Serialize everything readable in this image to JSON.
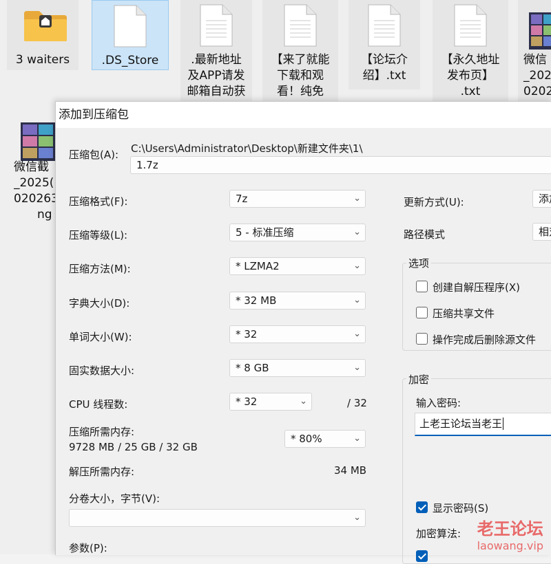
{
  "desktop": {
    "files": [
      {
        "label": "3 waiters"
      },
      {
        "label": ".DS_Store"
      },
      {
        "label_lines": [
          ".最新地址",
          "及APP请发",
          "邮箱自动获"
        ]
      },
      {
        "label_lines": [
          "【来了就能",
          "下载和观",
          "看！纯免"
        ]
      },
      {
        "label_lines": [
          "【论坛介",
          "绍】.txt"
        ]
      },
      {
        "label_lines": [
          "【永久地址",
          "发布页】",
          ".txt"
        ]
      },
      {
        "label_lines": [
          "微信",
          "_202",
          "0202"
        ]
      },
      {
        "label_lines": [
          "微信截",
          "_2025(",
          "020263",
          "ng"
        ]
      }
    ]
  },
  "dialog": {
    "title": "添加到压缩包",
    "archive_label": "压缩包(A):",
    "archive_path": "C:\\Users\\Administrator\\Desktop\\新建文件夹\\1\\",
    "archive_name": "1.7z",
    "format_label": "压缩格式(F):",
    "format_value": "7z",
    "level_label": "压缩等级(L):",
    "level_value": "5 - 标准压缩",
    "method_label": "压缩方法(M):",
    "method_value": "*  LZMA2",
    "dict_label": "字典大小(D):",
    "dict_value": "*  32 MB",
    "word_label": "单词大小(W):",
    "word_value": "*  32",
    "solid_label": "固实数据大小:",
    "solid_value": "*  8 GB",
    "cpu_label": "CPU 线程数:",
    "cpu_value": "*  32",
    "cpu_total": "/ 32",
    "mem_label": "压缩所需内存:",
    "mem_value": "9728 MB / 25 GB / 32 GB",
    "mem_percent": "*  80%",
    "decomp_label": "解压所需内存:",
    "decomp_value": "34 MB",
    "split_label": "分卷大小，字节(V):",
    "split_value": "",
    "params_label": "参数(P):",
    "update_label": "更新方式(U):",
    "update_value": "添加",
    "path_label": "路径模式",
    "path_value": "相对",
    "options_title": "选项",
    "opt_sfx": "创建自解压程序(X)",
    "opt_shared": "压缩共享文件",
    "opt_delete": "操作完成后删除源文件",
    "encrypt_title": "加密",
    "password_label": "输入密码:",
    "password_value": "上老王论坛当老王",
    "show_password": "显示密码(S)",
    "encrypt_method_label": "加密算法:"
  },
  "watermark": {
    "line1": "老王论坛",
    "line2": "laowang.vip"
  }
}
